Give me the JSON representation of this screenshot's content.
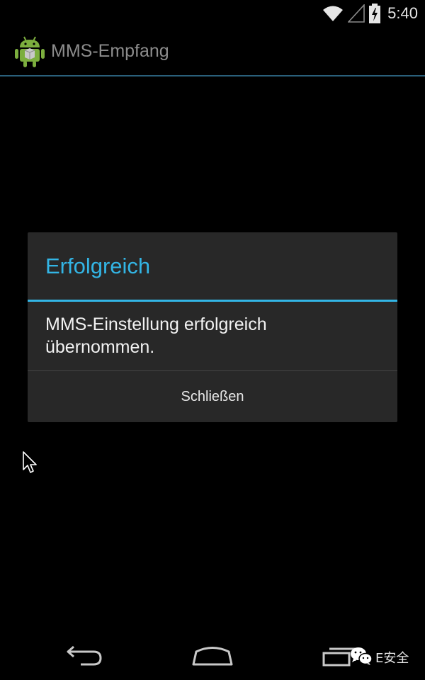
{
  "status_bar": {
    "time": "5:40",
    "icons": [
      "wifi-icon",
      "signal-icon",
      "battery-charging-icon"
    ]
  },
  "action_bar": {
    "title": "MMS-Empfang",
    "icon": "android-app-icon"
  },
  "dialog": {
    "title": "Erfolgreich",
    "message": "MMS-Einstellung erfolgreich übernommen.",
    "button_label": "Schließen"
  },
  "nav_bar": {
    "buttons": [
      "back-icon",
      "home-icon",
      "recent-apps-icon"
    ]
  },
  "watermark": {
    "text": "E安全",
    "icon": "wechat-icon"
  },
  "colors": {
    "accent": "#33b5e5",
    "dialog_bg": "#282828",
    "background": "#000000",
    "action_bar_divider": "#2a5f7a"
  }
}
